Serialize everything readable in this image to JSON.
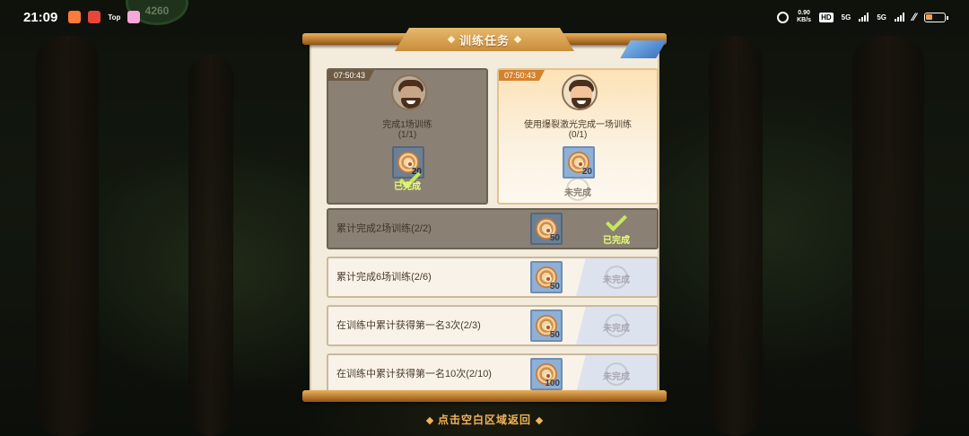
{
  "status_bar": {
    "time": "21:09",
    "app_top_label": "Top",
    "net_speed_value": "0.90",
    "net_speed_unit": "KB/s",
    "hd_label": "HD",
    "sim1_label": "5G",
    "sim2_label": "5G"
  },
  "background": {
    "gem_counter": "4260"
  },
  "panel": {
    "title": "训练任务",
    "cards": [
      {
        "timer": "07:50:43",
        "title": "完成1场训练",
        "progress": "(1/1)",
        "reward_qty": "20",
        "status": "已完成",
        "completed": true
      },
      {
        "timer": "07:50:43",
        "title": "使用爆裂激光完成一场训练",
        "progress": "(0/1)",
        "reward_qty": "20",
        "status": "未完成",
        "completed": false
      }
    ],
    "rows": [
      {
        "label": "累计完成2场训练(2/2)",
        "reward_qty": "50",
        "status": "已完成",
        "completed": true
      },
      {
        "label": "累计完成6场训练(2/6)",
        "reward_qty": "50",
        "status": "未完成",
        "completed": false
      },
      {
        "label": "在训练中累计获得第一名3次(2/3)",
        "reward_qty": "50",
        "status": "未完成",
        "completed": false
      },
      {
        "label": "在训练中累计获得第一名10次(2/10)",
        "reward_qty": "100",
        "status": "未完成",
        "completed": false
      }
    ]
  },
  "hint": "点击空白区域返回",
  "colors": {
    "accent_gold": "#e6b86c",
    "done_green": "#e9ff7a",
    "pending_gray": "#a8a8b2",
    "timer_orange": "#d4822d"
  },
  "icons": {
    "task_avatar": "bearded-trainer-avatar",
    "reward": "target-token-icon",
    "done": "check-icon"
  }
}
